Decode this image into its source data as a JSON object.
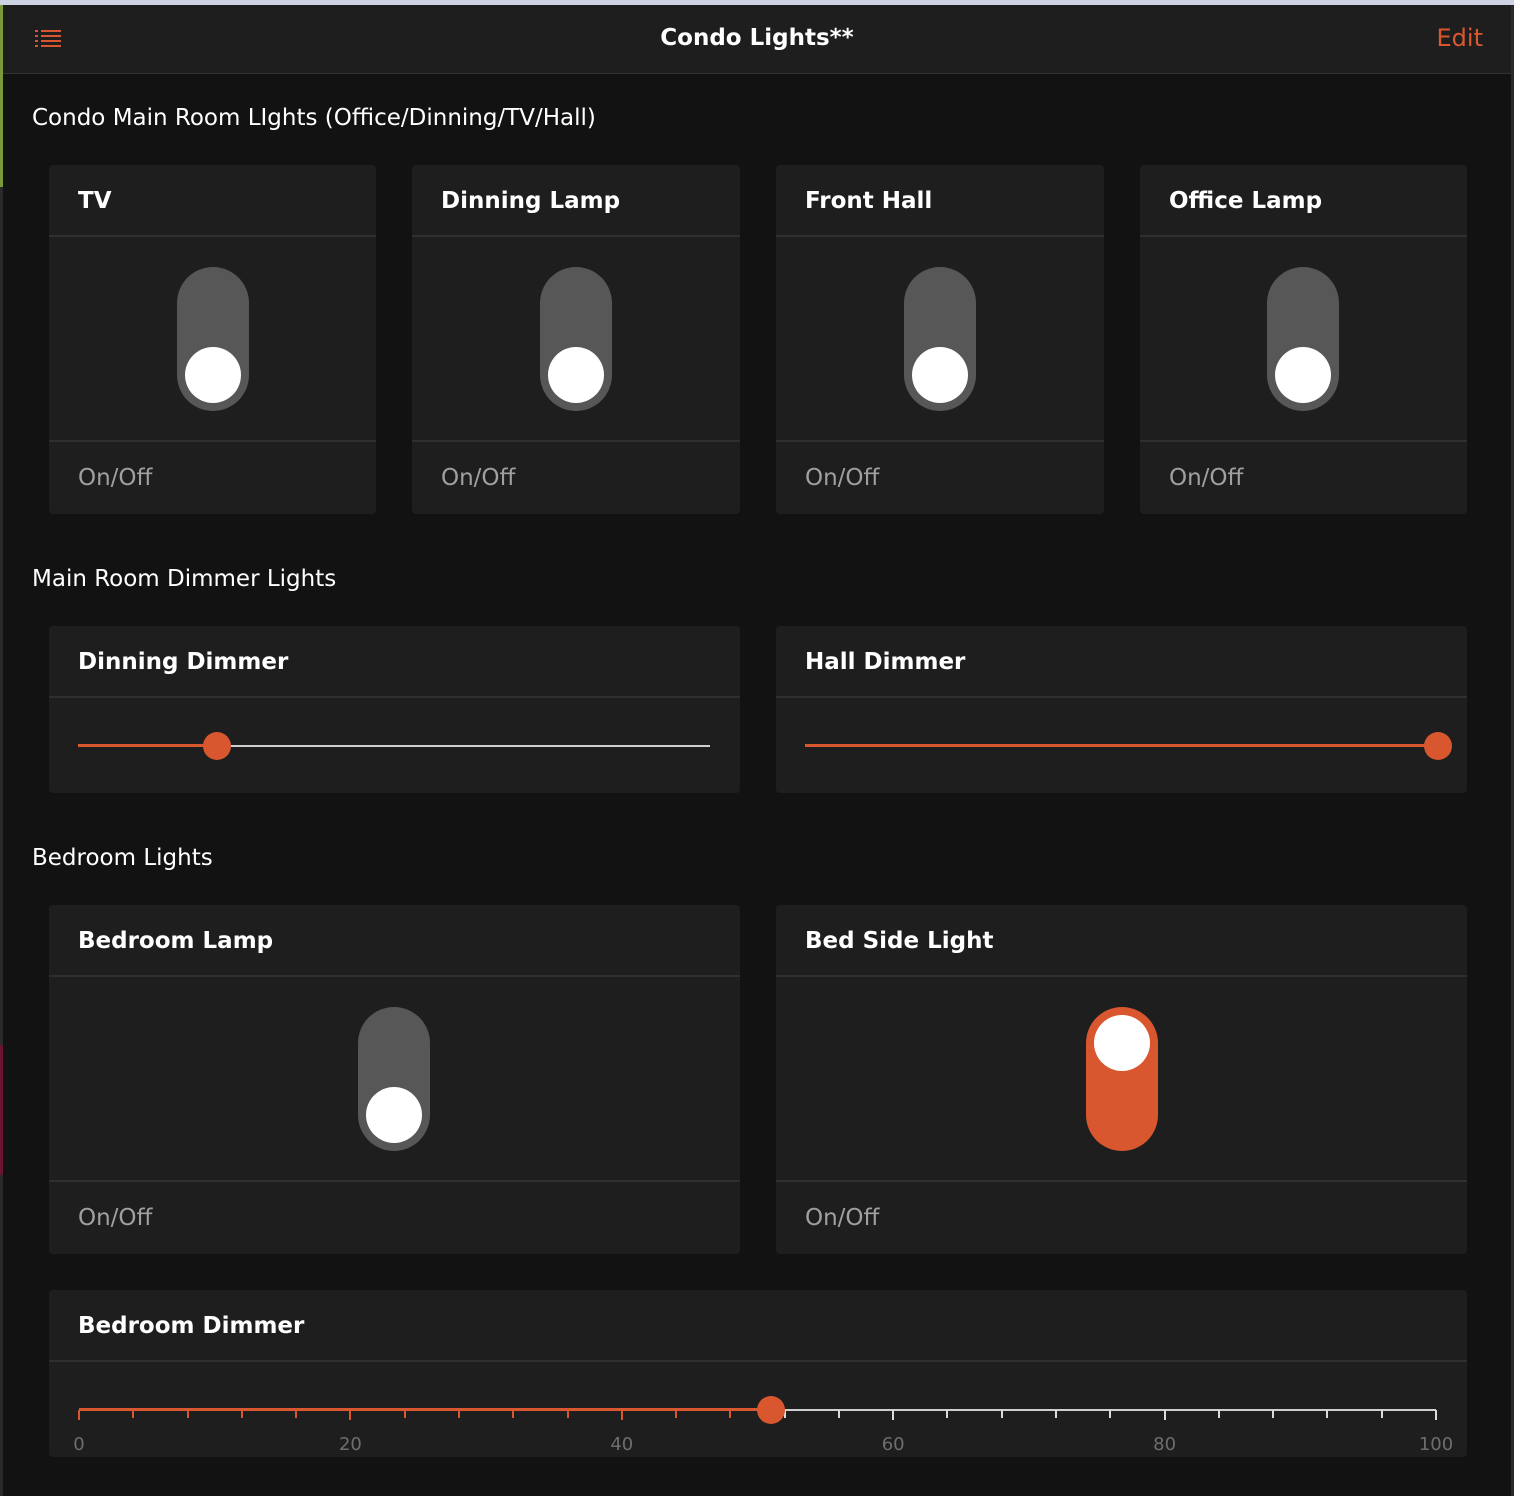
{
  "header": {
    "title": "Condo Lights**",
    "edit_label": "Edit",
    "menu_icon": "list-icon"
  },
  "accent_color": "#d9572e",
  "sections": [
    {
      "title": "Condo Main Room LIghts (Office/Dinning/TV/Hall)",
      "switches": [
        {
          "label": "TV",
          "footer": "On/Off",
          "state": "off"
        },
        {
          "label": "Dinning Lamp",
          "footer": "On/Off",
          "state": "off"
        },
        {
          "label": "Front Hall",
          "footer": "On/Off",
          "state": "off"
        },
        {
          "label": "Office Lamp",
          "footer": "On/Off",
          "state": "off"
        }
      ]
    },
    {
      "title": "Main Room Dimmer Lights",
      "dimmers": [
        {
          "label": "Dinning Dimmer",
          "value_fraction": 0.22
        },
        {
          "label": "Hall Dimmer",
          "value_fraction": 1.0
        }
      ]
    },
    {
      "title": "Bedroom Lights",
      "switches": [
        {
          "label": "Bedroom Lamp",
          "footer": "On/Off",
          "state": "off"
        },
        {
          "label": "Bed Side Light",
          "footer": "On/Off",
          "state": "on"
        }
      ],
      "dimmer": {
        "label": "Bedroom Dimmer",
        "value": 51,
        "min": 0,
        "max": 100,
        "tick_labels": [
          "0",
          "20",
          "40",
          "60",
          "80",
          "100"
        ]
      }
    }
  ]
}
